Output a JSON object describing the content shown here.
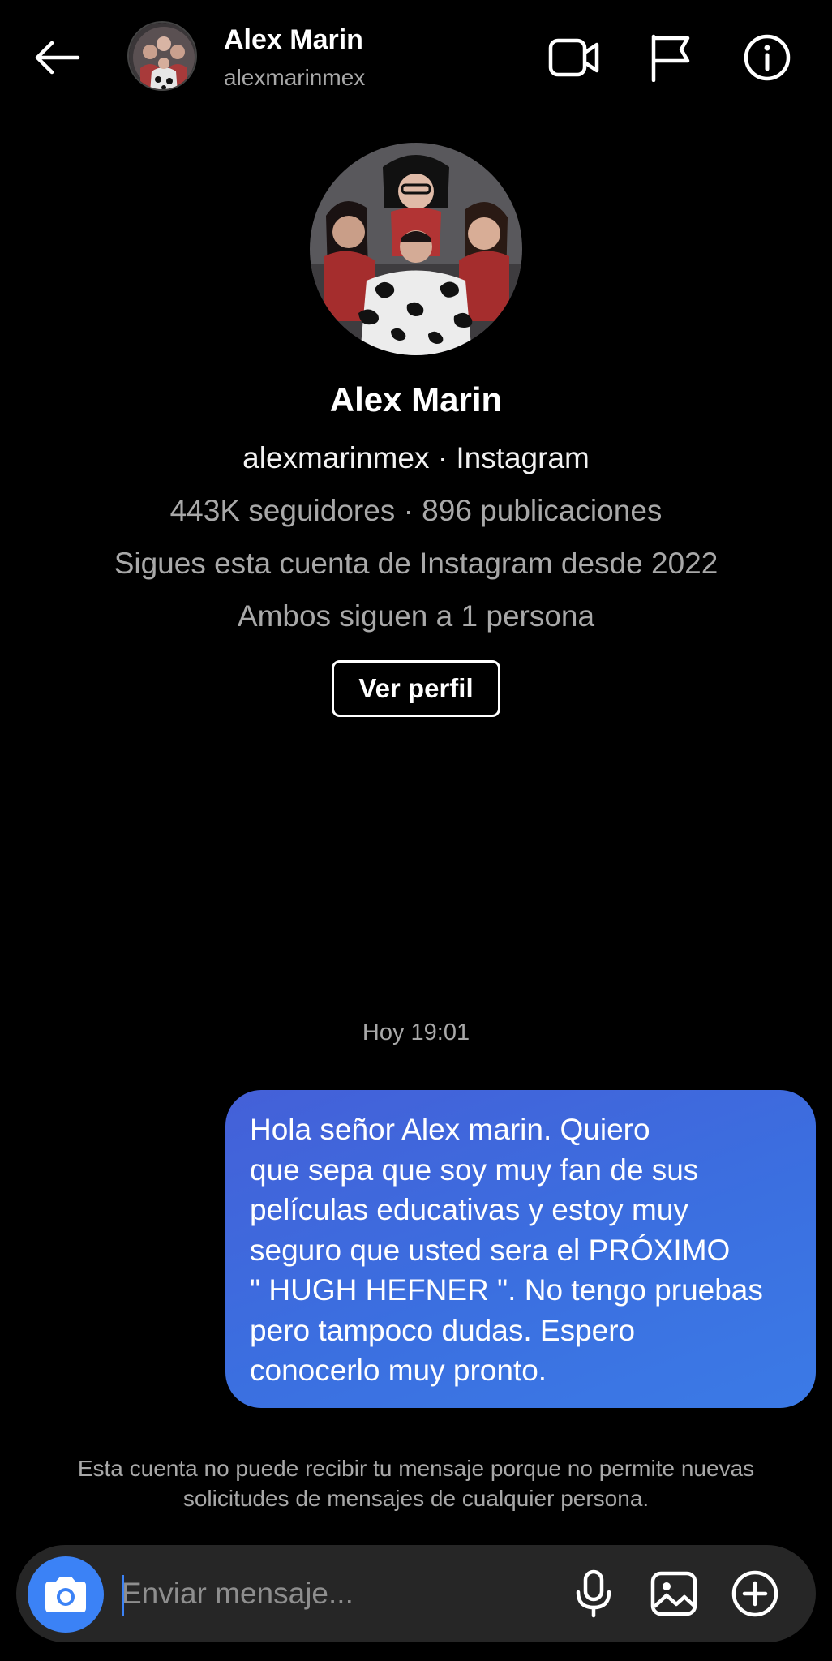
{
  "header": {
    "name": "Alex Marin",
    "username": "alexmarinmex",
    "icons": [
      "back-arrow-icon",
      "video-call-icon",
      "flag-icon",
      "info-icon"
    ]
  },
  "profile": {
    "name": "Alex Marin",
    "handle_line": "alexmarinmex · Instagram",
    "stats": "443K seguidores · 896 publicaciones",
    "following_since": "Sigues esta cuenta de Instagram desde 2022",
    "mutual": "Ambos siguen a 1 persona",
    "view_profile_label": "Ver perfil"
  },
  "conversation": {
    "timestamp": "Hoy 19:01",
    "messages": [
      {
        "sender": "me",
        "text": "Hola señor Alex marin. Quiero\nque sepa que soy muy fan de sus\npelículas educativas y estoy muy\nseguro que usted sera el PRÓXIMO\n\" HUGH HEFNER \". No tengo pruebas\npero tampoco dudas. Espero\nconocerlo muy pronto."
      }
    ],
    "notice": "Esta cuenta no puede recibir tu mensaje porque no permite nuevas solicitudes de mensajes de cualquier persona."
  },
  "composer": {
    "placeholder": "Enviar mensaje...",
    "icons": [
      "camera-icon",
      "microphone-icon",
      "gallery-icon",
      "add-icon"
    ]
  },
  "colors": {
    "background": "#000000",
    "bubble": "#3f6ee2",
    "accent": "#3b82f6",
    "secondary_text": "#a8a8a8",
    "composer": "#262626"
  }
}
